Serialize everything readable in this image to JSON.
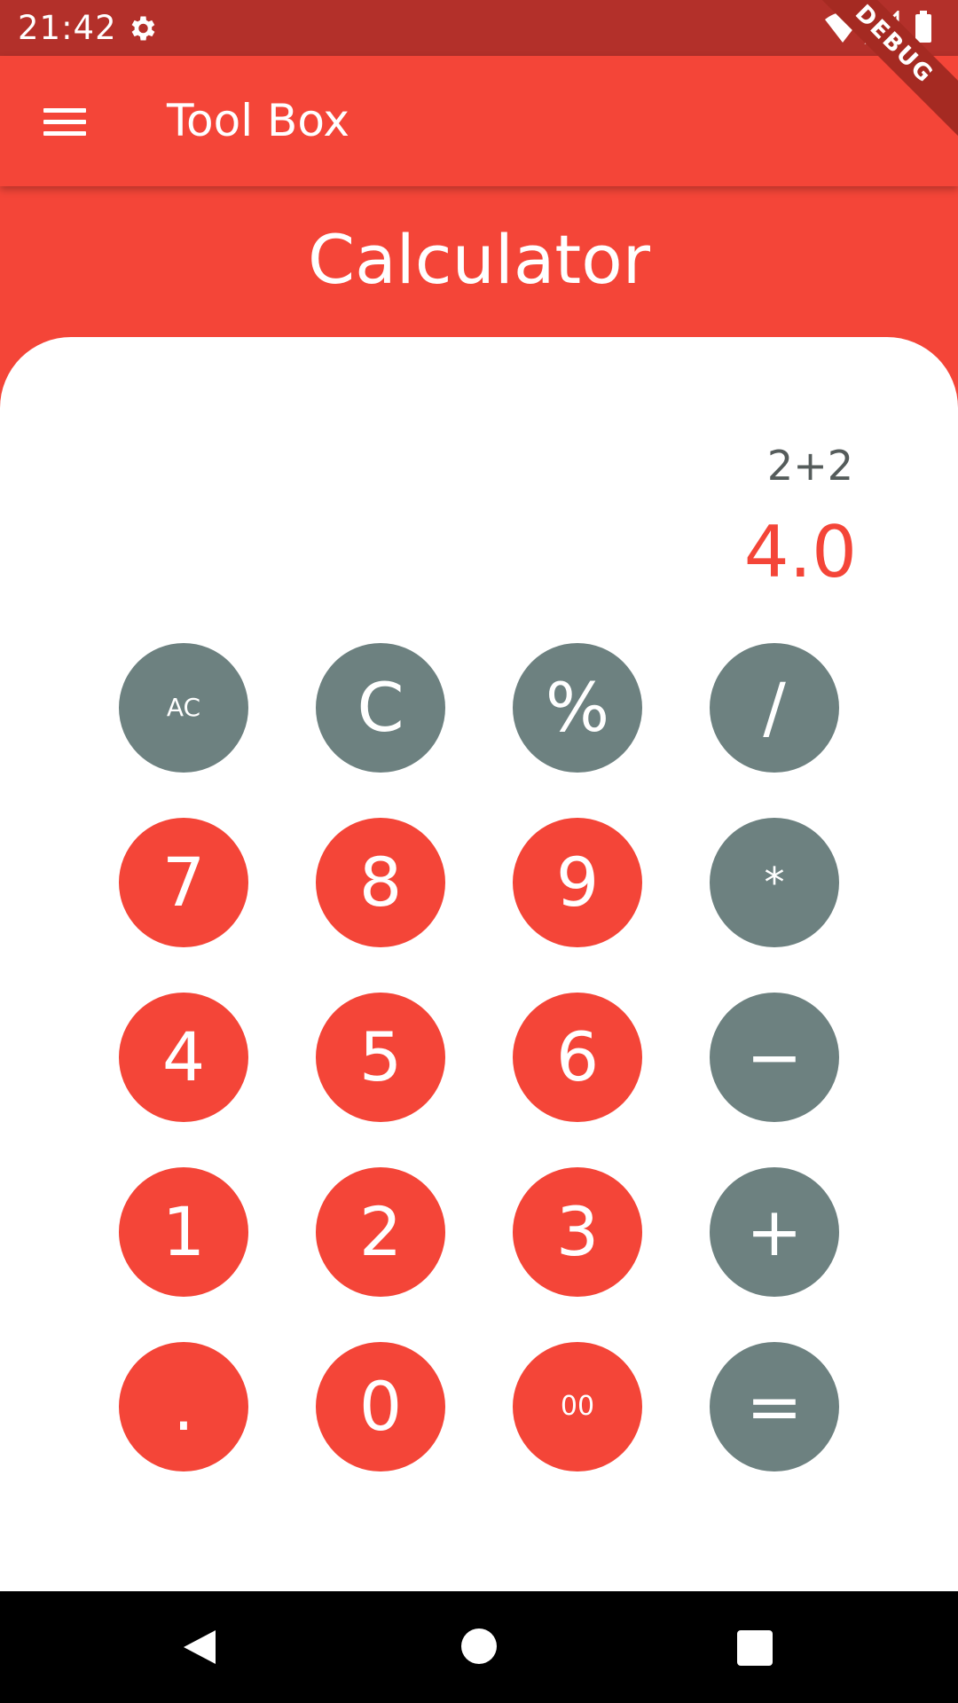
{
  "status_bar": {
    "time": "21:42",
    "icons": [
      "gear-icon",
      "wifi-icon",
      "signal-icon",
      "battery-icon"
    ],
    "debug_label": "DEBUG"
  },
  "app_bar": {
    "title": "Tool Box",
    "menu_icon": "hamburger-menu-icon"
  },
  "page": {
    "title": "Calculator"
  },
  "display": {
    "expression": "2+2",
    "result": "4.0"
  },
  "keypad": {
    "rows": [
      [
        "AC",
        "C",
        "%",
        "/"
      ],
      [
        "7",
        "8",
        "9",
        "*"
      ],
      [
        "4",
        "5",
        "6",
        "−"
      ],
      [
        "1",
        "2",
        "3",
        "+"
      ],
      [
        ".",
        "0",
        "00",
        "="
      ]
    ]
  },
  "colors": {
    "primary": "#F44538",
    "status_bar": "#B3302A",
    "operator_key": "#6D8180",
    "expression_text": "#555C5B"
  },
  "nav_bar": {
    "icons": [
      "back-icon",
      "home-icon",
      "recents-icon"
    ]
  }
}
